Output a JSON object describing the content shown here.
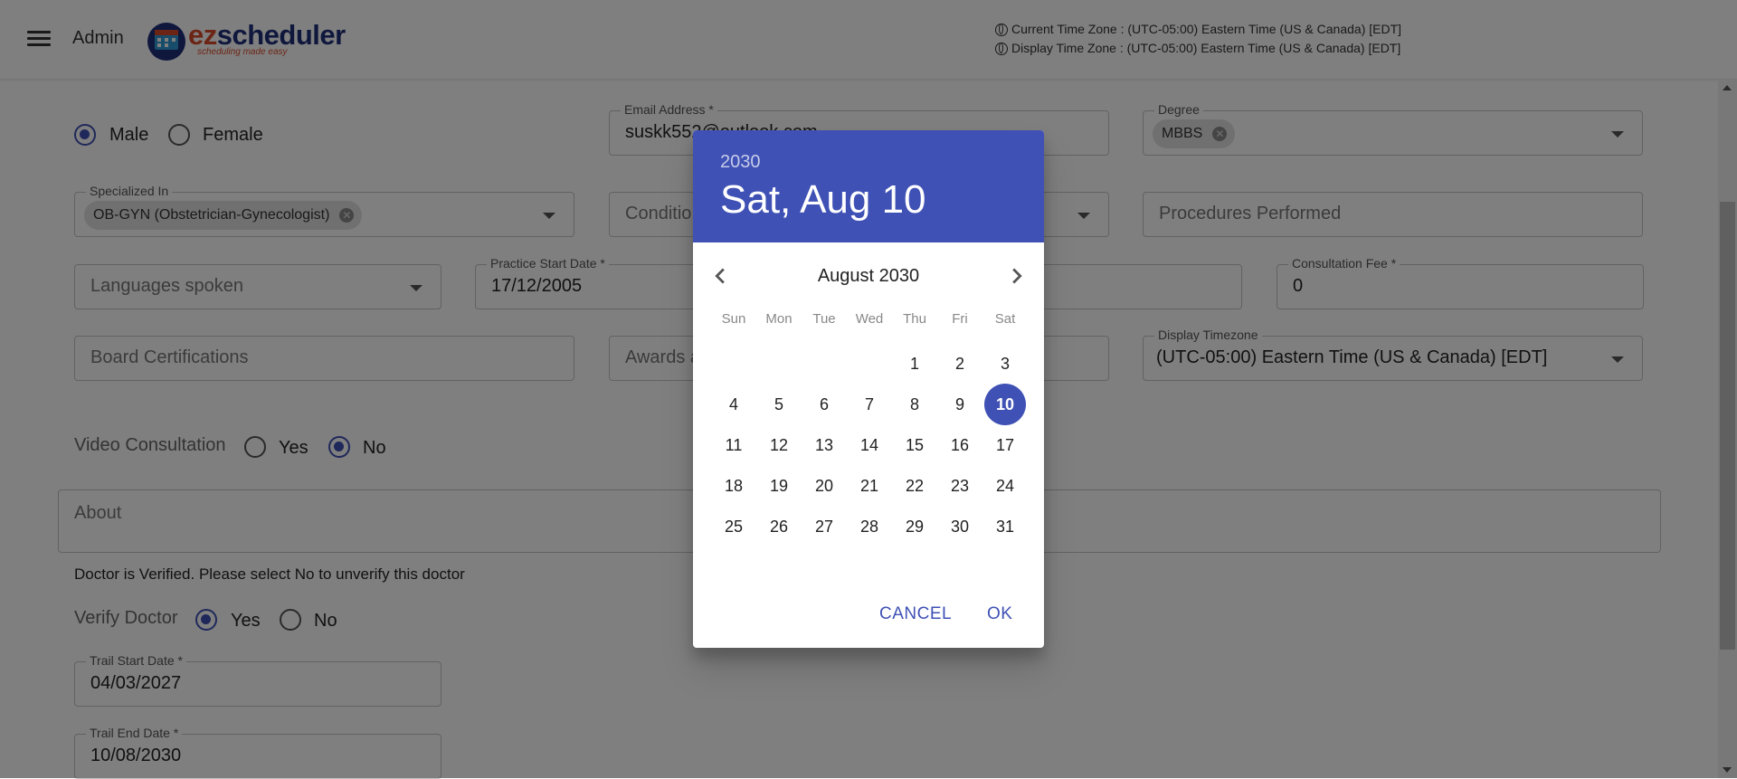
{
  "header": {
    "admin_label": "Admin",
    "logo_main": "scheduler",
    "logo_prefix": "ez",
    "logo_tagline": "scheduling made easy",
    "current_tz": "Current Time Zone : (UTC-05:00) Eastern Time (US & Canada) [EDT]",
    "display_tz": "Display Time Zone : (UTC-05:00) Eastern Time (US & Canada) [EDT]"
  },
  "form": {
    "gender": {
      "options": [
        "Male",
        "Female"
      ],
      "selected": "Male"
    },
    "email": {
      "label": "Email Address *",
      "value": "suskk552@outlook.com"
    },
    "degree": {
      "label": "Degree",
      "chip": "MBBS"
    },
    "specialized": {
      "label": "Specialized In",
      "chip": "OB-GYN (Obstetrician-Gynecologist)"
    },
    "conditions": {
      "placeholder": "Conditio"
    },
    "procedures": {
      "placeholder": "Procedures Performed"
    },
    "languages": {
      "placeholder": "Languages spoken"
    },
    "practice_start": {
      "label": "Practice Start Date *",
      "value": "17/12/2005"
    },
    "consultation_fee": {
      "label": "Consultation Fee  *",
      "value": "0"
    },
    "board_cert": {
      "placeholder": "Board Certifications"
    },
    "awards": {
      "placeholder": "Awards a"
    },
    "display_timezone": {
      "label": "Display Timezone",
      "value": "(UTC-05:00) Eastern Time (US & Canada) [EDT]"
    },
    "video_consultation": {
      "label": "Video Consultation",
      "options": [
        "Yes",
        "No"
      ],
      "selected": "No"
    },
    "about": {
      "placeholder": "About"
    },
    "verified_note": "Doctor is Verified. Please select No to unverify this doctor",
    "verify_doctor": {
      "label": "Verify Doctor",
      "options": [
        "Yes",
        "No"
      ],
      "selected": "Yes"
    },
    "trial_start": {
      "label": "Trail Start Date *",
      "value": "04/03/2027"
    },
    "trial_end": {
      "label": "Trail End Date *",
      "value": "10/08/2030"
    }
  },
  "datepicker": {
    "year": "2030",
    "selected_display": "Sat, Aug 10",
    "month_label": "August 2030",
    "weekdays": [
      "Sun",
      "Mon",
      "Tue",
      "Wed",
      "Thu",
      "Fri",
      "Sat"
    ],
    "first_weekday_index": 4,
    "days_in_month": 31,
    "selected_day": 10,
    "cancel_label": "CANCEL",
    "ok_label": "OK"
  },
  "colors": {
    "primary": "#3f51b5"
  }
}
